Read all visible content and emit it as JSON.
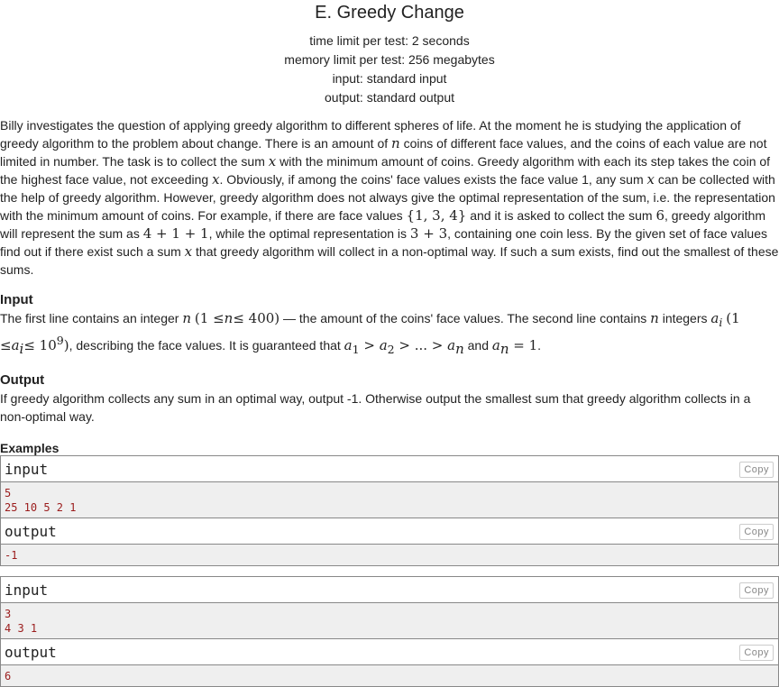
{
  "header": {
    "title": "E. Greedy Change",
    "time_limit": "time limit per test: 2 seconds",
    "memory_limit": "memory limit per test: 256 megabytes",
    "input": "input: standard input",
    "output": "output: standard output"
  },
  "statement": {
    "p1": "Billy investigates the question of applying greedy algorithm to different spheres of life. At the moment he is studying the application of greedy algorithm to the problem about change. There is an amount of",
    "var_n": "n",
    "p2": "coins of different face values, and the coins of each value are not limited in number. The task is to collect the sum",
    "var_x": "x",
    "p3": "with the minimum amount of coins. Greedy algorithm with each its step takes the coin of the highest face value, not exceeding",
    "p4": ". Obviously, if among the coins' face values exists the face value 1, any sum",
    "p5": "can be collected with the help of greedy algorithm. However, greedy algorithm does not always give the optimal representation of the sum, i.e. the representation with the minimum amount of coins. For example, if there are face values",
    "set_example": "{1, 3, 4}",
    "p6": "and it is asked to collect the sum",
    "sum_example": "6",
    "p7": ", greedy algorithm will represent the sum as",
    "greedy_repr": "4 + 1 + 1",
    "p8": ", while the optimal representation is",
    "optimal_repr": "3 + 3",
    "p9": ", containing one coin less. By the given set of face values find out if there exist such a sum",
    "p10": "that greedy algorithm will collect in a non-optimal way. If such a sum exists, find out the smallest of these sums."
  },
  "input_section": {
    "title": "Input",
    "t1": "The first line contains an integer",
    "constraint_n_open": "(1 ≤",
    "constraint_n_close": "≤ 400)",
    "t2": "— the amount of the coins' face values. The second line contains",
    "t3": "integers",
    "var_a": "a",
    "sub_i": "i",
    "constraint_a_open": "(1 ≤",
    "constraint_a_close": "≤ 10",
    "exp_9": "9",
    "paren_close": ")",
    "t4": ", describing the face values. It is guaranteed that",
    "sub_1": "1",
    "gt1": " > ",
    "sub_2": "2",
    "gt2": " > ... > ",
    "sub_n": "n",
    "t5": "and",
    "eq_one": " = 1",
    "dot": "."
  },
  "output_section": {
    "title": "Output",
    "text": "If greedy algorithm collects any sum in an optimal way, output -1. Otherwise output the smallest sum that greedy algorithm collects in a non-optimal way."
  },
  "examples": {
    "title": "Examples",
    "copy_label": "Copy",
    "tests": [
      {
        "input_label": "input",
        "input": "5\n25 10 5 2 1",
        "output_label": "output",
        "output": "-1"
      },
      {
        "input_label": "input",
        "input": "3\n4 3 1",
        "output_label": "output",
        "output": "6"
      }
    ]
  }
}
